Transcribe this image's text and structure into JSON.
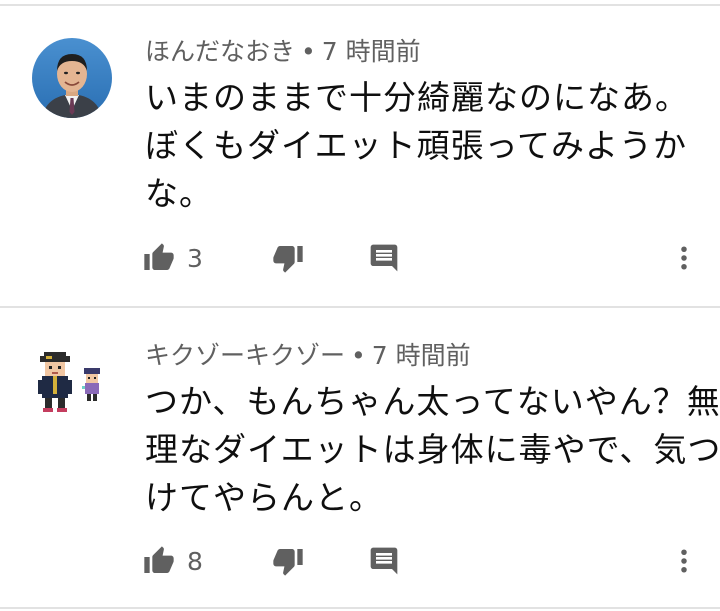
{
  "comments": [
    {
      "author": "ほんだなおき",
      "separator": "•",
      "time": "7 時間前",
      "lines": [
        "いまのままで十分綺麗なのになあ。",
        "ぼくもダイエット頑張ってみようか",
        "な。"
      ],
      "likes": "3",
      "avatar_icon": "person-photo-icon"
    },
    {
      "author": "キクゾーキクゾー",
      "separator": "•",
      "time": "7 時間前",
      "lines": [
        "つか、もんちゃん太ってないやん？無",
        "理なダイエットは身体に毒やで、気つ",
        "けてやらんと。"
      ],
      "likes": "8",
      "avatar_icon": "pixel-characters-icon"
    }
  ],
  "icons": {
    "like": "thumbs-up-icon",
    "dislike": "thumbs-down-icon",
    "reply": "comment-reply-icon",
    "more": "more-vert-icon"
  },
  "colors": {
    "icon": "#606060",
    "meta_text": "#606060",
    "body_text": "#0f0f0f",
    "divider": "#e2e2e2"
  }
}
